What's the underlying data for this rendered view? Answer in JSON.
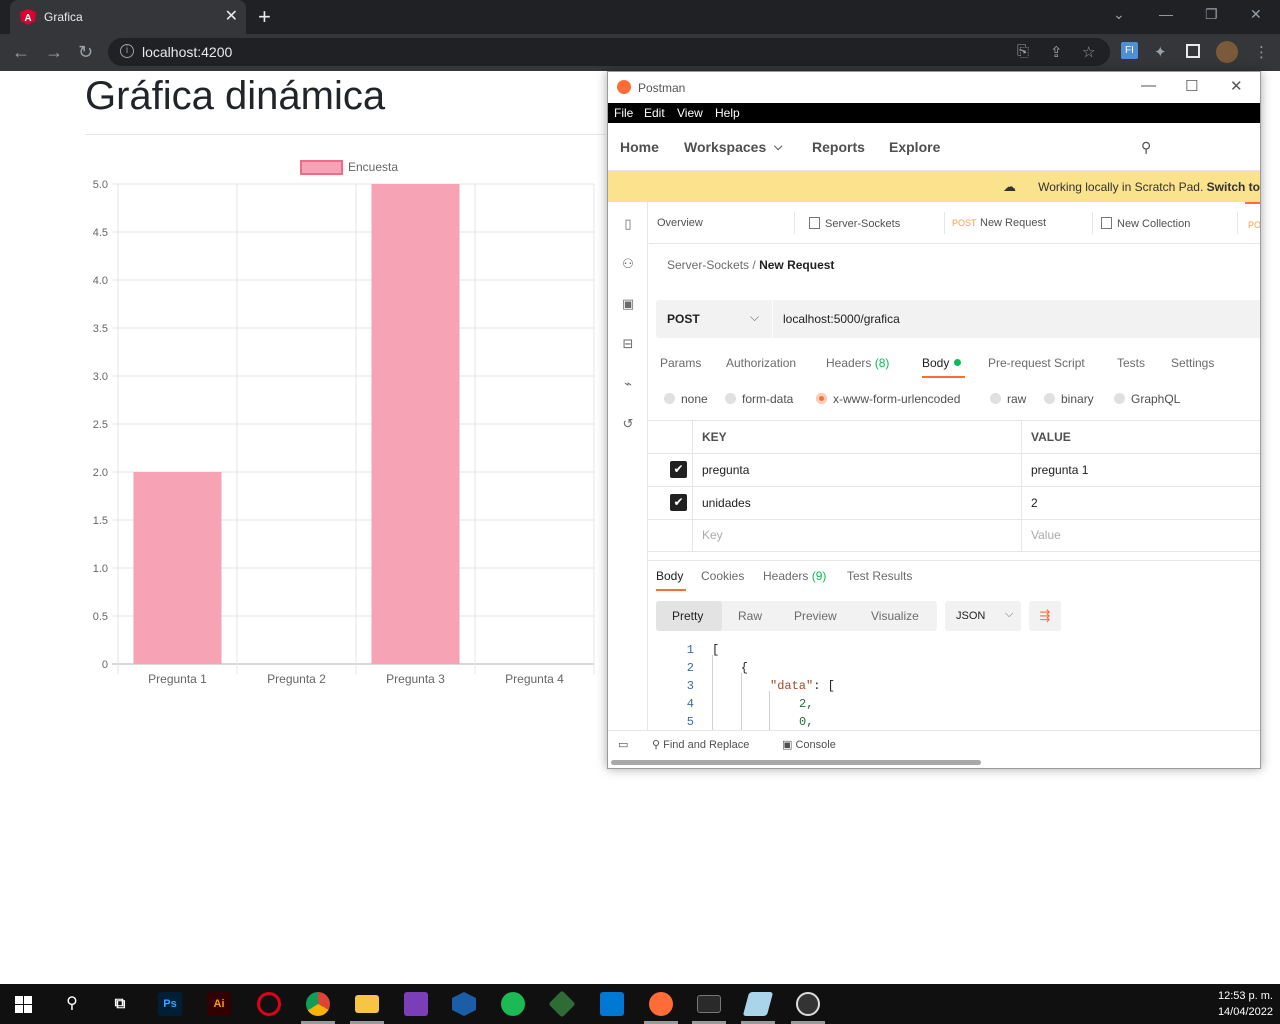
{
  "browser": {
    "tab_title": "Grafica",
    "url": "localhost:4200",
    "tab_close": "✕",
    "new_tab": "+"
  },
  "page": {
    "title": "Gráfica dinámica"
  },
  "chart_data": {
    "type": "bar",
    "categories": [
      "Pregunta 1",
      "Pregunta 2",
      "Pregunta 3",
      "Pregunta 4"
    ],
    "series": [
      {
        "name": "Encuesta",
        "values": [
          2,
          0,
          5,
          0
        ]
      }
    ],
    "ylim": [
      0,
      5
    ],
    "yticks": [
      "5.0",
      "4.5",
      "4.0",
      "3.5",
      "3.0",
      "2.5",
      "2.0",
      "1.5",
      "1.0",
      "0.5",
      "0"
    ],
    "legend": "top",
    "bar_color": "#f5a3b5",
    "bar_border": "#ee6b89",
    "grid": true
  },
  "postman": {
    "window_title": "Postman",
    "menu": [
      "File",
      "Edit",
      "View",
      "Help"
    ],
    "nav": {
      "home": "Home",
      "workspaces": "Workspaces",
      "reports": "Reports",
      "explore": "Explore"
    },
    "banner": {
      "text": "Working locally in Scratch Pad.",
      "action": "Switch to"
    },
    "tabs": {
      "overview": "Overview",
      "server_sockets": "Server-Sockets",
      "new_request_method": "POST",
      "new_request": "New Request",
      "new_collection": "New Collection",
      "partial_method": "PO"
    },
    "breadcrumb": {
      "collection": "Server-Sockets",
      "separator": "/",
      "request": "New Request"
    },
    "request": {
      "method": "POST",
      "url": "localhost:5000/grafica"
    },
    "request_tabs": {
      "params": "Params",
      "authorization": "Authorization",
      "headers": "Headers",
      "headers_count": "(8)",
      "body": "Body",
      "pre_request": "Pre-request Script",
      "tests": "Tests",
      "settings": "Settings"
    },
    "body_types": [
      "none",
      "form-data",
      "x-www-form-urlencoded",
      "raw",
      "binary",
      "GraphQL"
    ],
    "kv_table": {
      "key_header": "KEY",
      "value_header": "VALUE",
      "rows": [
        {
          "key": "pregunta",
          "value": "pregunta 1"
        },
        {
          "key": "unidades",
          "value": "2"
        }
      ],
      "key_placeholder": "Key",
      "value_placeholder": "Value"
    },
    "response_tabs": {
      "body": "Body",
      "cookies": "Cookies",
      "headers": "Headers",
      "headers_count": "(9)",
      "test_results": "Test Results"
    },
    "format_tabs": {
      "pretty": "Pretty",
      "raw": "Raw",
      "preview": "Preview",
      "visualize": "Visualize"
    },
    "language": "JSON",
    "code_lines": [
      {
        "n": "1",
        "text": "["
      },
      {
        "n": "2",
        "text": "    {"
      },
      {
        "n": "3",
        "key": "\"data\"",
        "text": ": ["
      },
      {
        "n": "4",
        "text": "2,"
      },
      {
        "n": "5",
        "text": "0,"
      }
    ],
    "footer": {
      "find_replace": "Find and Replace",
      "console": "Console"
    }
  },
  "taskbar": {
    "time": "12:53 p. m.",
    "date": "14/04/2022",
    "apps": [
      "windows-start",
      "search",
      "task-view",
      "photoshop",
      "illustrator",
      "opera",
      "chrome",
      "file-explorer",
      "visual-studio",
      "virtualbox",
      "spotify",
      "git-kraken",
      "vscode",
      "postman",
      "terminal",
      "notepad",
      "obs"
    ]
  }
}
